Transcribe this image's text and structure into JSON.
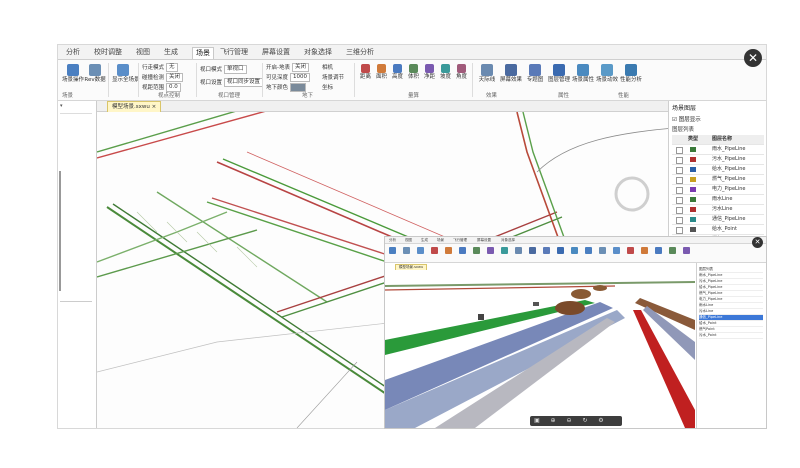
{
  "menu_tabs": [
    "分析",
    "校时调整",
    "视图",
    "生成",
    "场景",
    "飞行管理",
    "屏幕设置",
    "对象选择",
    "三维分析"
  ],
  "active_tab": "场景",
  "ribbon": {
    "buttons": [
      {
        "label": "场景操作",
        "icon": "scene-icon",
        "color": "#4a7fc1"
      },
      {
        "label": "Rev数据",
        "icon": "rev-icon",
        "color": "#6b8fb5"
      },
      {
        "label": "显示全场景",
        "icon": "fullscene-icon",
        "color": "#5a8ec9"
      }
    ],
    "scene_rows": [
      {
        "label": "行走模式",
        "value": "无"
      },
      {
        "label": "碰撞检测",
        "value": "关闭"
      },
      {
        "label": "视距范围",
        "value": "0.0"
      }
    ],
    "view_rows": [
      {
        "label": "视口模式",
        "value": "单视口"
      },
      {
        "label": "视口设置",
        "value": "视口同步设置"
      }
    ],
    "ground_rows": [
      {
        "label": "开启-地表",
        "value": "关闭"
      },
      {
        "label": "可见深度",
        "value": "1000"
      },
      {
        "label": "地下颜色",
        "value": ""
      }
    ],
    "ground_opts": [
      "相机",
      "场景调节",
      "坐标"
    ],
    "measure_buttons": [
      "距离",
      "面积",
      "高度",
      "体积",
      "净距",
      "坡度",
      "角度"
    ],
    "effects_buttons": [
      "天际线",
      "屏幕效果",
      "专题图",
      "图层管理",
      "场景属性",
      "场景动效",
      "性能分析"
    ],
    "groups": [
      "场景",
      "视点控制",
      "视口管理",
      "地下",
      "量算",
      "效果",
      "属性",
      "性能"
    ]
  },
  "doc_tab": "模型场景.sxwu",
  "right_panel": {
    "title": "场景图层",
    "checkbox": "图层显示",
    "subtitle": "图层列表",
    "headers": [
      "",
      "类型",
      "图层名称"
    ],
    "rows": [
      {
        "name": "雨水_PipeLine",
        "color": "#3a7a3a"
      },
      {
        "name": "污水_PipeLine",
        "color": "#b03030"
      },
      {
        "name": "给水_PipeLine",
        "color": "#2a5fa8"
      },
      {
        "name": "燃气_PipeLine",
        "color": "#c8a020"
      },
      {
        "name": "电力_PipeLine",
        "color": "#7a3ab0"
      },
      {
        "name": "雨水Line",
        "color": "#3a7a3a"
      },
      {
        "name": "污水Line",
        "color": "#b03030"
      },
      {
        "name": "通信_PipeLine",
        "color": "#2a8a8a"
      },
      {
        "name": "给水_Point",
        "color": "#555555"
      },
      {
        "name": "燃气Point",
        "color": "#c8a020"
      }
    ]
  },
  "inset": {
    "tabs": [
      "分析",
      "视图",
      "生成",
      "场景",
      "飞行管理",
      "屏幕设置",
      "对象选择"
    ],
    "doc_tab": "模型场景.sxwu",
    "panel_rows": [
      "图层列表",
      "雨水_PipeLine",
      "污水_PipeLine",
      "给水_PipeLine",
      "燃气_PipeLine",
      "电力_PipeLine",
      "雨水Line",
      "污水Line",
      "通信_PipeLine",
      "给水_Point",
      "燃气Point",
      "污水_Point"
    ],
    "selected_row": 8
  }
}
